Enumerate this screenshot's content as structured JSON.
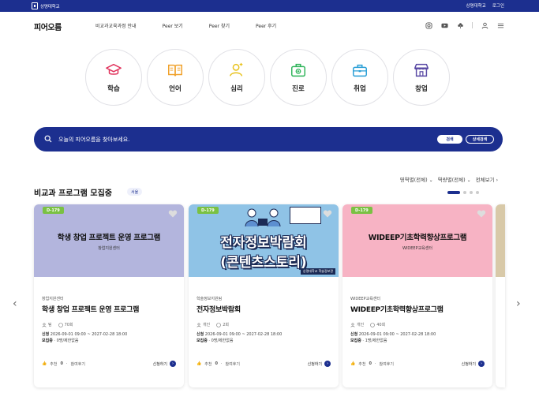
{
  "topbar": {
    "university": "상명대학교",
    "links": [
      "상명대학교",
      "로그인"
    ]
  },
  "header": {
    "brand": "피어오름",
    "nav": [
      "비교과교육과정 안내",
      "Peer 보기",
      "Peer 찾기",
      "Peer 후기"
    ],
    "icons": [
      "instagram-icon",
      "youtube-icon",
      "flower-icon",
      "user-icon",
      "menu-icon"
    ]
  },
  "categories": [
    {
      "label": "학습",
      "icon": "graduation-cap-icon",
      "color": "#e0305a"
    },
    {
      "label": "언어",
      "icon": "book-icon",
      "color": "#f0a12a"
    },
    {
      "label": "심리",
      "icon": "person-icon",
      "color": "#e8c21b"
    },
    {
      "label": "진로",
      "icon": "first-aid-kit-icon",
      "color": "#2fb45a"
    },
    {
      "label": "취업",
      "icon": "briefcase-icon",
      "color": "#2a9fd6"
    },
    {
      "label": "창업",
      "icon": "shop-icon",
      "color": "#5a4aa5"
    }
  ],
  "search": {
    "placeholder": "오늘의 피어오름을 찾아보세요.",
    "search_label": "검색",
    "detail_label": "상세검색"
  },
  "filters": {
    "area": "영역별(전체)",
    "competency": "역량별(전체)",
    "view_all": "전체보기"
  },
  "section": {
    "title": "비교과 프로그램 모집중",
    "region": "서울"
  },
  "cards": [
    {
      "dday": "D-179",
      "thumb_title": "학생 창업 프로젝트 운영 프로그램",
      "thumb_sub": "창업지원센터",
      "thumb_color": "#b3b5dd",
      "org": "창업지원센터",
      "title": "학생 창업 프로젝트 운영 프로그램",
      "meta_a": "팀",
      "meta_b": "70회",
      "apply_period_label": "신청",
      "apply_period": "2026-09-01 09:00 ~ 2027-02-28 18:00",
      "status": "모집중",
      "status_detail": "0명/제한없음",
      "likes_label": "추천",
      "likes": "0",
      "review": "참여후기",
      "apply_label": "신청하기"
    },
    {
      "dday": "D-179",
      "poster_line1": "전자정보박람회",
      "poster_line2": "(콘텐츠스토리)",
      "poster_tag": "상명대학교 학술정보관",
      "org": "학술정보지원팀",
      "title": "전자정보박람회",
      "meta_a": "개인",
      "meta_b": "2회",
      "apply_period_label": "신청",
      "apply_period": "2026-09-01 09:00 ~ 2027-02-28 18:00",
      "status": "모집중",
      "status_detail": "0명/제한없음",
      "likes_label": "추천",
      "likes": "0",
      "review": "참여후기",
      "apply_label": "신청하기"
    },
    {
      "dday": "D-179",
      "thumb_title": "WIDEEP기초학력향상프로그램",
      "thumb_sub": "WIDEEP교육센터",
      "thumb_color": "#f7b3c4",
      "org": "WIDEEP교육센터",
      "title": "WIDEEP기초학력향상프로그램",
      "meta_a": "개인",
      "meta_b": "40회",
      "apply_period_label": "신청",
      "apply_period": "2026-09-01 09:00 ~ 2027-02-28 18:00",
      "status": "모집중",
      "status_detail": "1명/제한없음",
      "likes_label": "추천",
      "likes": "0",
      "review": "참여후기",
      "apply_label": "신청하기"
    }
  ],
  "carousel": {
    "prev": "‹",
    "next": "›"
  }
}
